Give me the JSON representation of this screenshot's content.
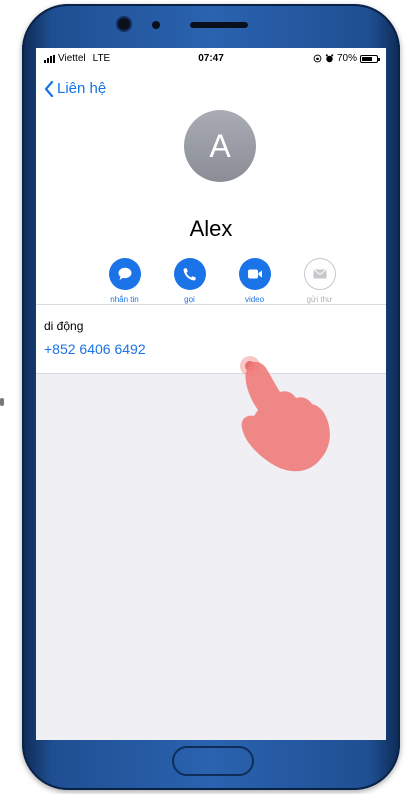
{
  "status_bar": {
    "carrier": "Viettel",
    "network": "LTE",
    "time": "07:47",
    "battery": "70%",
    "battery_level": 0.7
  },
  "nav": {
    "back_label": "Liên hệ"
  },
  "contact": {
    "initial": "A",
    "name": "Alex"
  },
  "actions": [
    {
      "label": "nhắn tin",
      "icon": "message-icon",
      "enabled": true
    },
    {
      "label": "gọi",
      "icon": "phone-icon",
      "enabled": true
    },
    {
      "label": "video",
      "icon": "video-icon",
      "enabled": true
    },
    {
      "label": "gửi thư",
      "icon": "mail-icon",
      "enabled": false
    }
  ],
  "phone_field": {
    "label": "di động",
    "number": "+852 6406 6492"
  },
  "colors": {
    "accent": "#1b73e8",
    "phone_frame": "#2a63b0",
    "screen_bg": "#efeff4",
    "tap_hand": "#f07b7b"
  }
}
